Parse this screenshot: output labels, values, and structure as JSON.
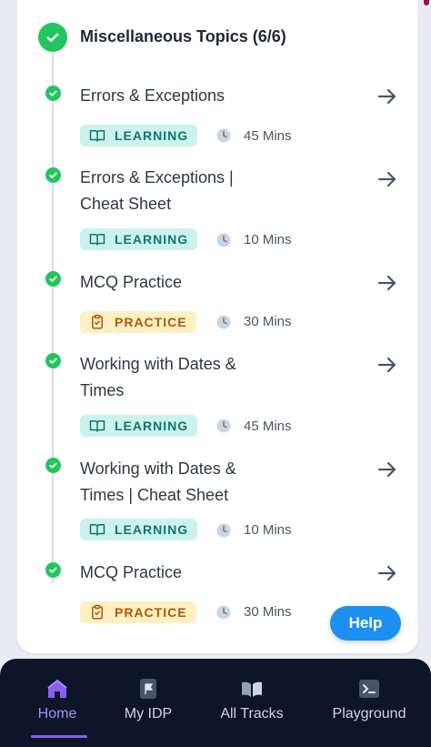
{
  "section": {
    "title": "Miscellaneous Topics (6/6)"
  },
  "items": [
    {
      "title": "Errors & Exceptions",
      "tag": "LEARNING",
      "duration": "45 Mins"
    },
    {
      "title": "Errors & Exceptions | Cheat Sheet",
      "tag": "LEARNING",
      "duration": "10 Mins"
    },
    {
      "title": "MCQ Practice",
      "tag": "PRACTICE",
      "duration": "30 Mins"
    },
    {
      "title": "Working with Dates & Times",
      "tag": "LEARNING",
      "duration": "45 Mins"
    },
    {
      "title": "Working with Dates & Times | Cheat Sheet",
      "tag": "LEARNING",
      "duration": "10 Mins"
    },
    {
      "title": "MCQ Practice",
      "tag": "PRACTICE",
      "duration": "30 Mins"
    }
  ],
  "help": {
    "label": "Help"
  },
  "nav": {
    "items": [
      {
        "label": "Home",
        "icon": "home-icon",
        "active": true
      },
      {
        "label": "My IDP",
        "icon": "flag-document-icon",
        "active": false
      },
      {
        "label": "All Tracks",
        "icon": "open-book-icon",
        "active": false
      },
      {
        "label": "Playground",
        "icon": "terminal-icon",
        "active": false
      }
    ]
  },
  "colors": {
    "complete_green": "#22c55e",
    "learning_bg": "#ccf2ee",
    "learning_text": "#0f766e",
    "practice_bg": "#fdf1c4",
    "practice_text": "#b45309",
    "help_blue": "#1d8ff0",
    "nav_bg": "#0d1628",
    "nav_active": "#a78bfa"
  }
}
